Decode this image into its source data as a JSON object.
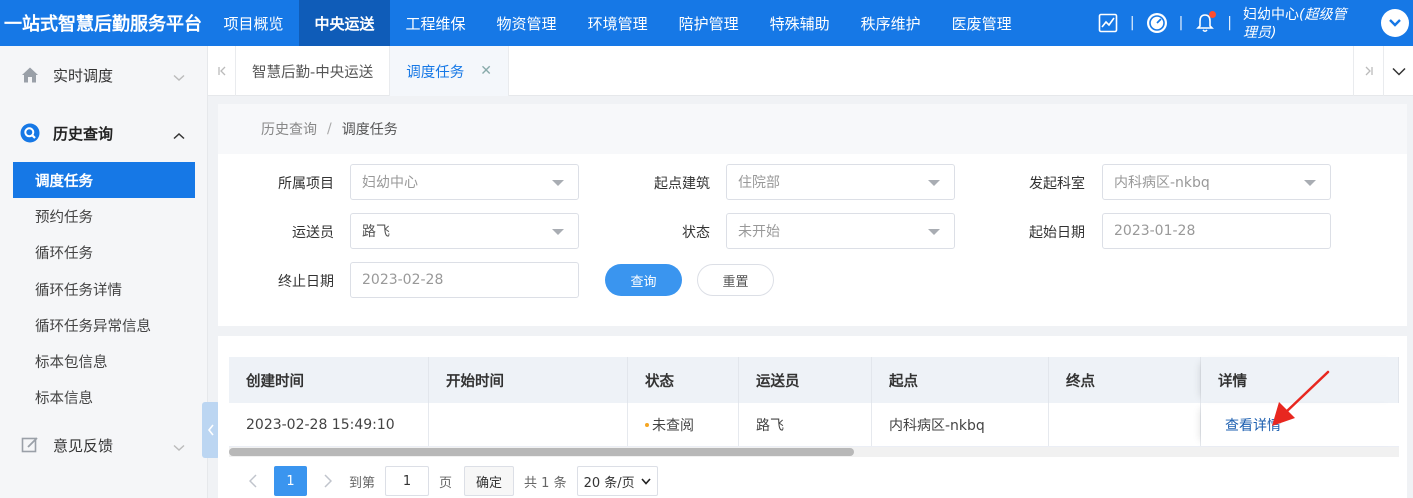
{
  "app": {
    "brand": "一站式智慧后勤服务平台"
  },
  "topnav": [
    {
      "label": "项目概览",
      "active": false
    },
    {
      "label": "中央运送",
      "active": true
    },
    {
      "label": "工程维保",
      "active": false
    },
    {
      "label": "物资管理",
      "active": false
    },
    {
      "label": "环境管理",
      "active": false
    },
    {
      "label": "陪护管理",
      "active": false
    },
    {
      "label": "特殊辅助",
      "active": false
    },
    {
      "label": "秩序维护",
      "active": false
    },
    {
      "label": "医废管理",
      "active": false
    }
  ],
  "user": {
    "name_line1": "妇幼中心",
    "role_inline": "(超级管",
    "role_line2": "理员)"
  },
  "sidebar": {
    "groups": [
      {
        "label": "实时调度",
        "icon": "home-icon",
        "open": false
      },
      {
        "label": "历史查询",
        "icon": "search-icon",
        "open": true
      },
      {
        "label": "意见反馈",
        "icon": "edit-icon",
        "open": false
      }
    ],
    "sub_items": [
      {
        "label": "调度任务",
        "active": true
      },
      {
        "label": "预约任务",
        "active": false
      },
      {
        "label": "循环任务",
        "active": false
      },
      {
        "label": "循环任务详情",
        "active": false
      },
      {
        "label": "循环任务异常信息",
        "active": false
      },
      {
        "label": "标本包信息",
        "active": false
      },
      {
        "label": "标本信息",
        "active": false
      }
    ]
  },
  "tabs": [
    {
      "label": "智慧后勤-中央运送",
      "active": false,
      "closable": false
    },
    {
      "label": "调度任务",
      "active": true,
      "closable": true
    }
  ],
  "breadcrumb": {
    "parent": "历史查询",
    "separator": "/",
    "current": "调度任务"
  },
  "filters": {
    "project": {
      "label": "所属项目",
      "value": "妇幼中心"
    },
    "start_building": {
      "label": "起点建筑",
      "value": "住院部"
    },
    "dept": {
      "label": "发起科室",
      "value": "内科病区-nkbq"
    },
    "courier": {
      "label": "运送员",
      "value": "路飞"
    },
    "status": {
      "label": "状态",
      "value": "未开始"
    },
    "start_date": {
      "label": "起始日期",
      "value": "2023-01-28"
    },
    "end_date": {
      "label": "终止日期",
      "value": "2023-02-28"
    },
    "query_button": "查询",
    "reset_button": "重置"
  },
  "table": {
    "columns": [
      "创建时间",
      "开始时间",
      "状态",
      "运送员",
      "起点",
      "终点",
      "详情"
    ],
    "rows": [
      {
        "created": "2023-02-28 15:49:10",
        "started": "",
        "status": "未查阅",
        "courier": "路飞",
        "origin": "内科病区-nkbq",
        "destination": "",
        "detail_link": "查看详情"
      }
    ]
  },
  "pagination": {
    "current_page": "1",
    "goto_prefix": "到第",
    "goto_value": "1",
    "goto_suffix": "页",
    "confirm": "确定",
    "total": "共 1 条",
    "page_size": "20 条/页"
  },
  "colors": {
    "primary": "#1678e6",
    "primary_dark": "#0f5cb8",
    "button_blue": "#3a95ef",
    "status_dot": "#f5a623",
    "annotation_arrow": "#e8271f"
  }
}
